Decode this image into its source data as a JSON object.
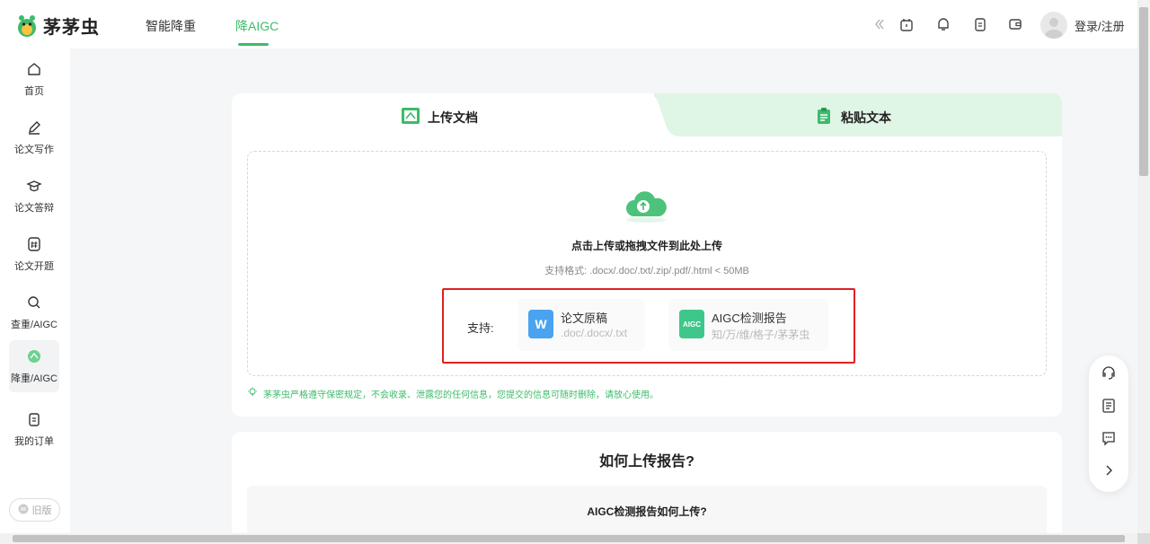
{
  "brand": {
    "name": "茅茅虫"
  },
  "nav": {
    "items": [
      {
        "label": "智能降重"
      },
      {
        "label": "降AIGC"
      }
    ]
  },
  "header": {
    "login_label": "登录/注册"
  },
  "sidebar": {
    "items": [
      {
        "label": "首页",
        "icon": "home-icon"
      },
      {
        "label": "论文写作",
        "icon": "pen-icon"
      },
      {
        "label": "论文答辩",
        "icon": "graduation-cap-icon"
      },
      {
        "label": "论文开题",
        "icon": "hash-icon"
      },
      {
        "label": "查重/AIGC",
        "icon": "search-icon"
      },
      {
        "label": "降重/AIGC",
        "icon": "reduce-icon"
      },
      {
        "label": "我的订单",
        "icon": "clipboard-icon"
      }
    ],
    "old_version_label": "旧版"
  },
  "upload": {
    "tabs": [
      {
        "label": "上传文档"
      },
      {
        "label": "粘贴文本"
      }
    ],
    "drop_title": "点击上传或拖拽文件到此处上传",
    "drop_sub": "支持格式: .docx/.doc/.txt/.zip/.pdf/.html < 50MB",
    "support_label": "支持:",
    "formats": [
      {
        "name": "论文原稿",
        "ext": ".doc/.docx/.txt",
        "icon_text": "W"
      },
      {
        "name": "AIGC检测报告",
        "ext": "知/万/维/格子/茅茅虫",
        "icon_text": "AIGC"
      }
    ],
    "privacy": "茅茅虫严格遵守保密规定，不会收录、泄露您的任何信息，您提交的信息可随时删除，请放心使用。"
  },
  "faq": {
    "title": "如何上传报告?",
    "question": "AIGC检测报告如何上传?"
  },
  "colors": {
    "accent": "#3dbb6b",
    "highlight": "#e02020",
    "wps_blue": "#4aa3f0",
    "aigc_green": "#3ec78a"
  }
}
